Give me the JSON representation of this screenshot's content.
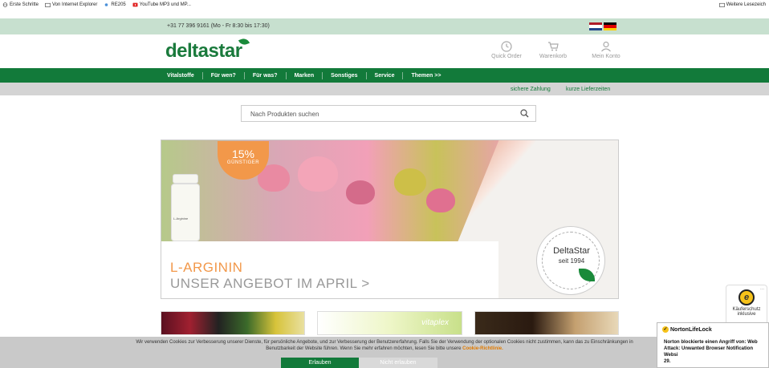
{
  "bookmarks": {
    "items": [
      {
        "label": "Erste Schritte",
        "icon": "globe-icon"
      },
      {
        "label": "Von Internet Explorer",
        "icon": "folder-icon"
      },
      {
        "label": "RE205",
        "icon": "plugin-icon"
      },
      {
        "label": "YouTube MP3 und MP...",
        "icon": "youtube-icon"
      }
    ],
    "right_label": "Weitere Lesezeich"
  },
  "topbar": {
    "phone": "+31 77 396 9161 (Mo - Fr 8:30 bis 17:30)",
    "flags": [
      "nl-flag",
      "de-flag"
    ]
  },
  "header": {
    "logo": "deltastar",
    "icons": [
      {
        "label": "Quick Order",
        "icon": "clock-icon"
      },
      {
        "label": "Warenkorb",
        "icon": "cart-icon"
      },
      {
        "label": "Mein Konto",
        "icon": "user-icon"
      }
    ]
  },
  "nav": {
    "items": [
      "Vitalstoffe",
      "Für wen?",
      "Für was?",
      "Marken",
      "Sonstiges",
      "Service",
      "Themen >>"
    ]
  },
  "subbar": {
    "items": [
      "sichere Zahlung",
      "kurze Lieferzeiten"
    ]
  },
  "search": {
    "placeholder": "Nach Produkten suchen"
  },
  "hero": {
    "badge_pct": "15%",
    "badge_text": "GÜNSTIGER",
    "line1": "L-ARGININ",
    "line2": "UNSER ANGEBOT IM APRIL >",
    "bottle_label": "L-Arginine",
    "seal_name": "DeltaStar",
    "seal_year": "seit 1994"
  },
  "tiles": {
    "tile2_text": "vitaplex"
  },
  "cookie": {
    "text1": "Wir verwenden Cookies zur Verbesserung unserer Dienste, für persönliche Angebote, und zur Verbesserung der Benutzererfahrung. Falls Sie der Verwendung der optionalen Cookies nicht zustimmen, kann das zu Einschränkungen in",
    "text2": "Benutzbarkeit der Website führen. Wenn Sie mehr erfahren möchten, lesen Sie bitte unsere",
    "link": "Cookie-Richtlinie.",
    "accept": "Erlauben",
    "decline": "Nicht erlauben"
  },
  "trusted": {
    "label": "Käuferschutz inklusive",
    "symbol": "e",
    "menu": "..."
  },
  "norton": {
    "brand": "NortonLifeLock",
    "message": "Norton blockierte einen Angriff von: Web Attack: Unwanted Browser Notification Websi",
    "message2": "29."
  },
  "colors": {
    "brand_green": "#127a3a",
    "accent_orange": "#f2984a",
    "topbar_bg": "#c7e0cf"
  }
}
